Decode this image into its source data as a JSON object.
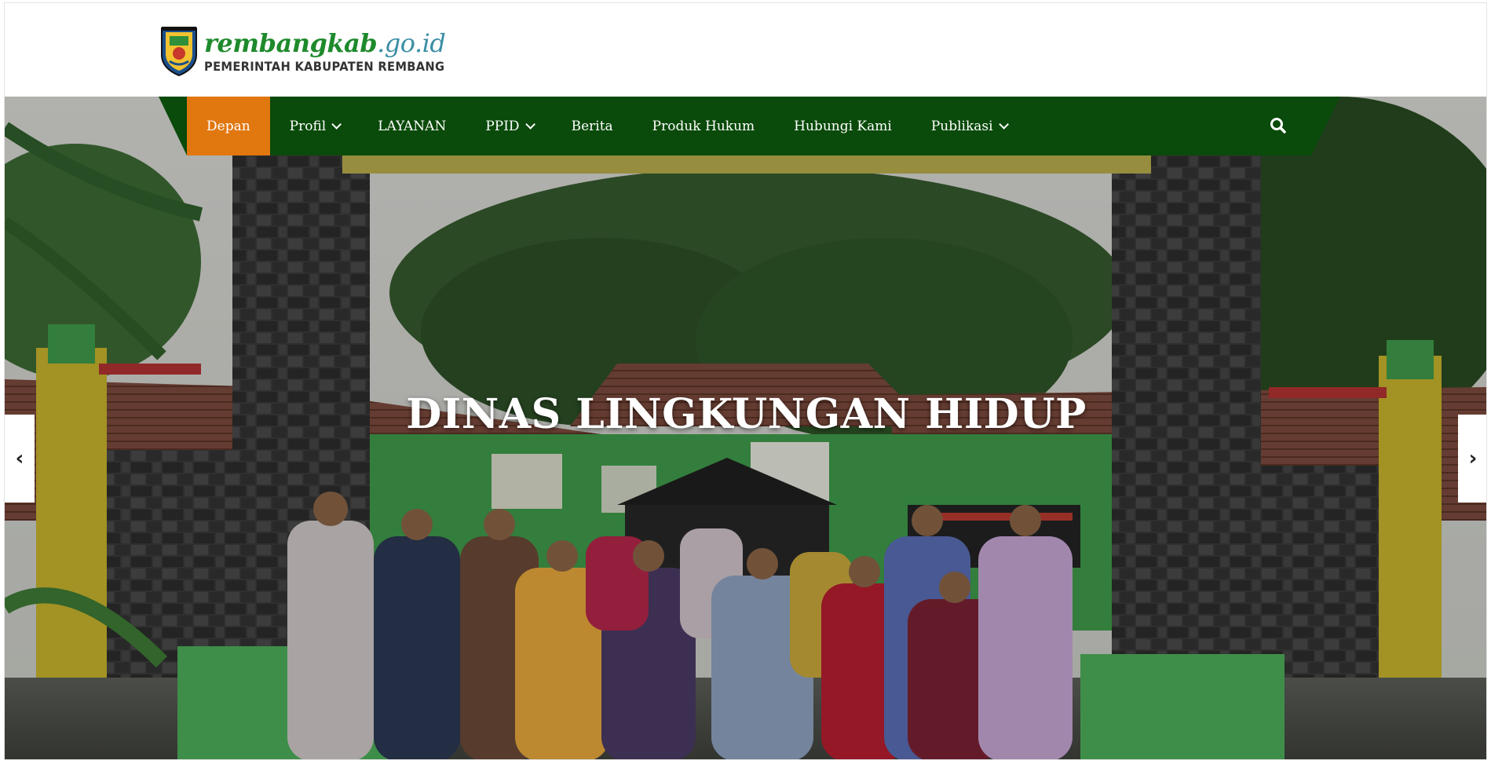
{
  "header": {
    "site_name_main": "rembangkab",
    "site_name_domain": ".go.id",
    "subtitle": "PEMERINTAH KABUPATEN REMBANG"
  },
  "nav": {
    "items": [
      {
        "label": "Depan",
        "dropdown": false,
        "active": true
      },
      {
        "label": "Profil",
        "dropdown": true
      },
      {
        "label": "LAYANAN",
        "dropdown": false
      },
      {
        "label": "PPID",
        "dropdown": true
      },
      {
        "label": "Berita",
        "dropdown": false
      },
      {
        "label": "Produk Hukum",
        "dropdown": false
      },
      {
        "label": "Hubungi Kami",
        "dropdown": false
      },
      {
        "label": "Publikasi",
        "dropdown": true
      }
    ],
    "search_icon": "search-icon"
  },
  "slider": {
    "title": "DINAS LINGKUNGAN HIDUP",
    "prev_icon": "chevron-left-icon",
    "next_icon": "chevron-right-icon"
  },
  "colors": {
    "nav_bg": "#0a4a0a",
    "nav_active": "#e1770f",
    "brand_green": "#1e8a2c",
    "brand_blue": "#3b8ea5"
  }
}
